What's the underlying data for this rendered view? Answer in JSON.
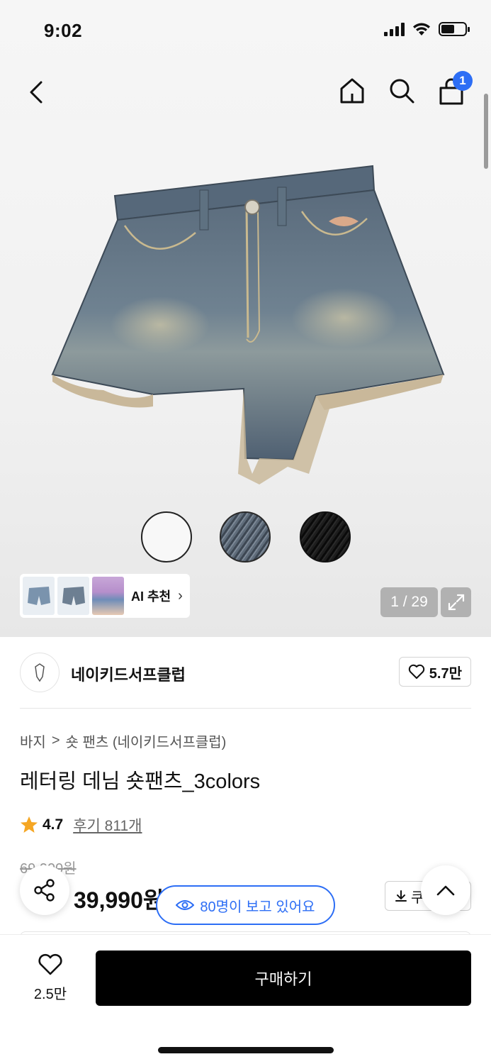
{
  "status": {
    "time": "9:02"
  },
  "nav": {
    "cart_count": "1"
  },
  "gallery": {
    "counter": "1 / 29",
    "ai_label": "AI 추천",
    "swatches": [
      "white",
      "denim",
      "black"
    ]
  },
  "brand": {
    "name": "네이키드서프클럽",
    "likes": "5.7만"
  },
  "product": {
    "breadcrumb_category": "바지",
    "breadcrumb_separator": ">",
    "breadcrumb_sub": "숏 팬츠 (네이키드서프클럽)",
    "title": "레터링 데님 숏팬츠_3colors",
    "rating": "4.7",
    "reviews": "후기 811개",
    "original_price": "69,000원",
    "price": "39,990원",
    "coupon_label": "쿠폰"
  },
  "viewers": {
    "text": "80명이 보고 있어요"
  },
  "bottom": {
    "wish_count": "2.5만",
    "buy_label": "구매하기"
  },
  "colors": {
    "accent": "#2d6ef5",
    "primary": "#000000",
    "star": "#f5a623"
  },
  "icons": [
    "back-icon",
    "home-icon",
    "search-icon",
    "cart-icon",
    "expand-icon",
    "heart-icon",
    "share-icon",
    "eye-icon",
    "download-icon",
    "chevron-up-icon",
    "star-icon"
  ]
}
